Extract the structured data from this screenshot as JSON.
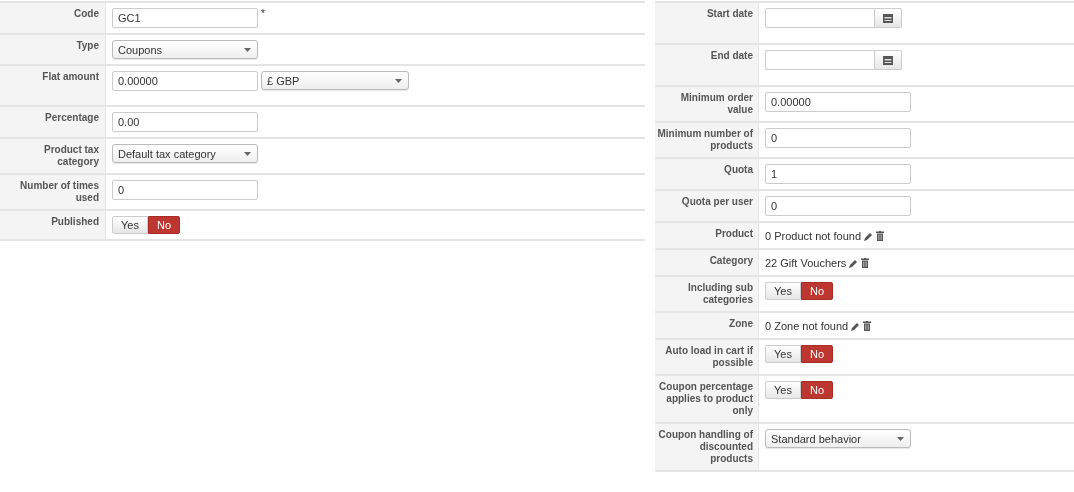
{
  "left_form": {
    "rows": [
      {
        "label": "Code",
        "kind": "text",
        "value": "GC1",
        "required_mark": "*"
      },
      {
        "label": "Type",
        "kind": "select",
        "value": "Coupons"
      },
      {
        "label": "Flat amount",
        "kind": "amount",
        "value": "0.00000",
        "currency": "£ GBP"
      },
      {
        "label": "Percentage",
        "kind": "text",
        "value": "0.00"
      },
      {
        "label": "Product tax category",
        "kind": "select",
        "value": "Default tax category"
      },
      {
        "label": "Number of times used",
        "kind": "text",
        "value": "0"
      },
      {
        "label": "Published",
        "kind": "toggle",
        "options": [
          {
            "label": "Yes",
            "selected": false
          },
          {
            "label": "No",
            "selected": true
          }
        ]
      }
    ]
  },
  "right_form": {
    "rows": [
      {
        "label": "Start date",
        "kind": "date"
      },
      {
        "label": "End date",
        "kind": "date"
      },
      {
        "label": "Minimum order value",
        "kind": "text",
        "value": "0.00000"
      },
      {
        "label": "Minimum number of products",
        "kind": "text",
        "value": "0"
      },
      {
        "label": "Quota",
        "kind": "text",
        "value": "1"
      },
      {
        "label": "Quota per user",
        "kind": "text",
        "value": "0"
      },
      {
        "label": "Product",
        "kind": "reference",
        "value": "0 Product not found"
      },
      {
        "label": "Category",
        "kind": "reference",
        "value": "22 Gift Vouchers"
      },
      {
        "label": "Including sub categories",
        "kind": "toggle",
        "options": [
          {
            "label": "Yes",
            "selected": false
          },
          {
            "label": "No",
            "selected": true
          }
        ]
      },
      {
        "label": "Zone",
        "kind": "reference",
        "value": "0 Zone not found"
      },
      {
        "label": "Auto load in cart if possible",
        "kind": "toggle",
        "options": [
          {
            "label": "Yes",
            "selected": false
          },
          {
            "label": "No",
            "selected": true
          }
        ]
      },
      {
        "label": "Coupon percentage applies to product only",
        "kind": "toggle",
        "options": [
          {
            "label": "Yes",
            "selected": false
          },
          {
            "label": "No",
            "selected": true
          }
        ]
      },
      {
        "label": "Coupon handling of discounted products",
        "kind": "select",
        "value": "Standard behavior"
      }
    ]
  }
}
